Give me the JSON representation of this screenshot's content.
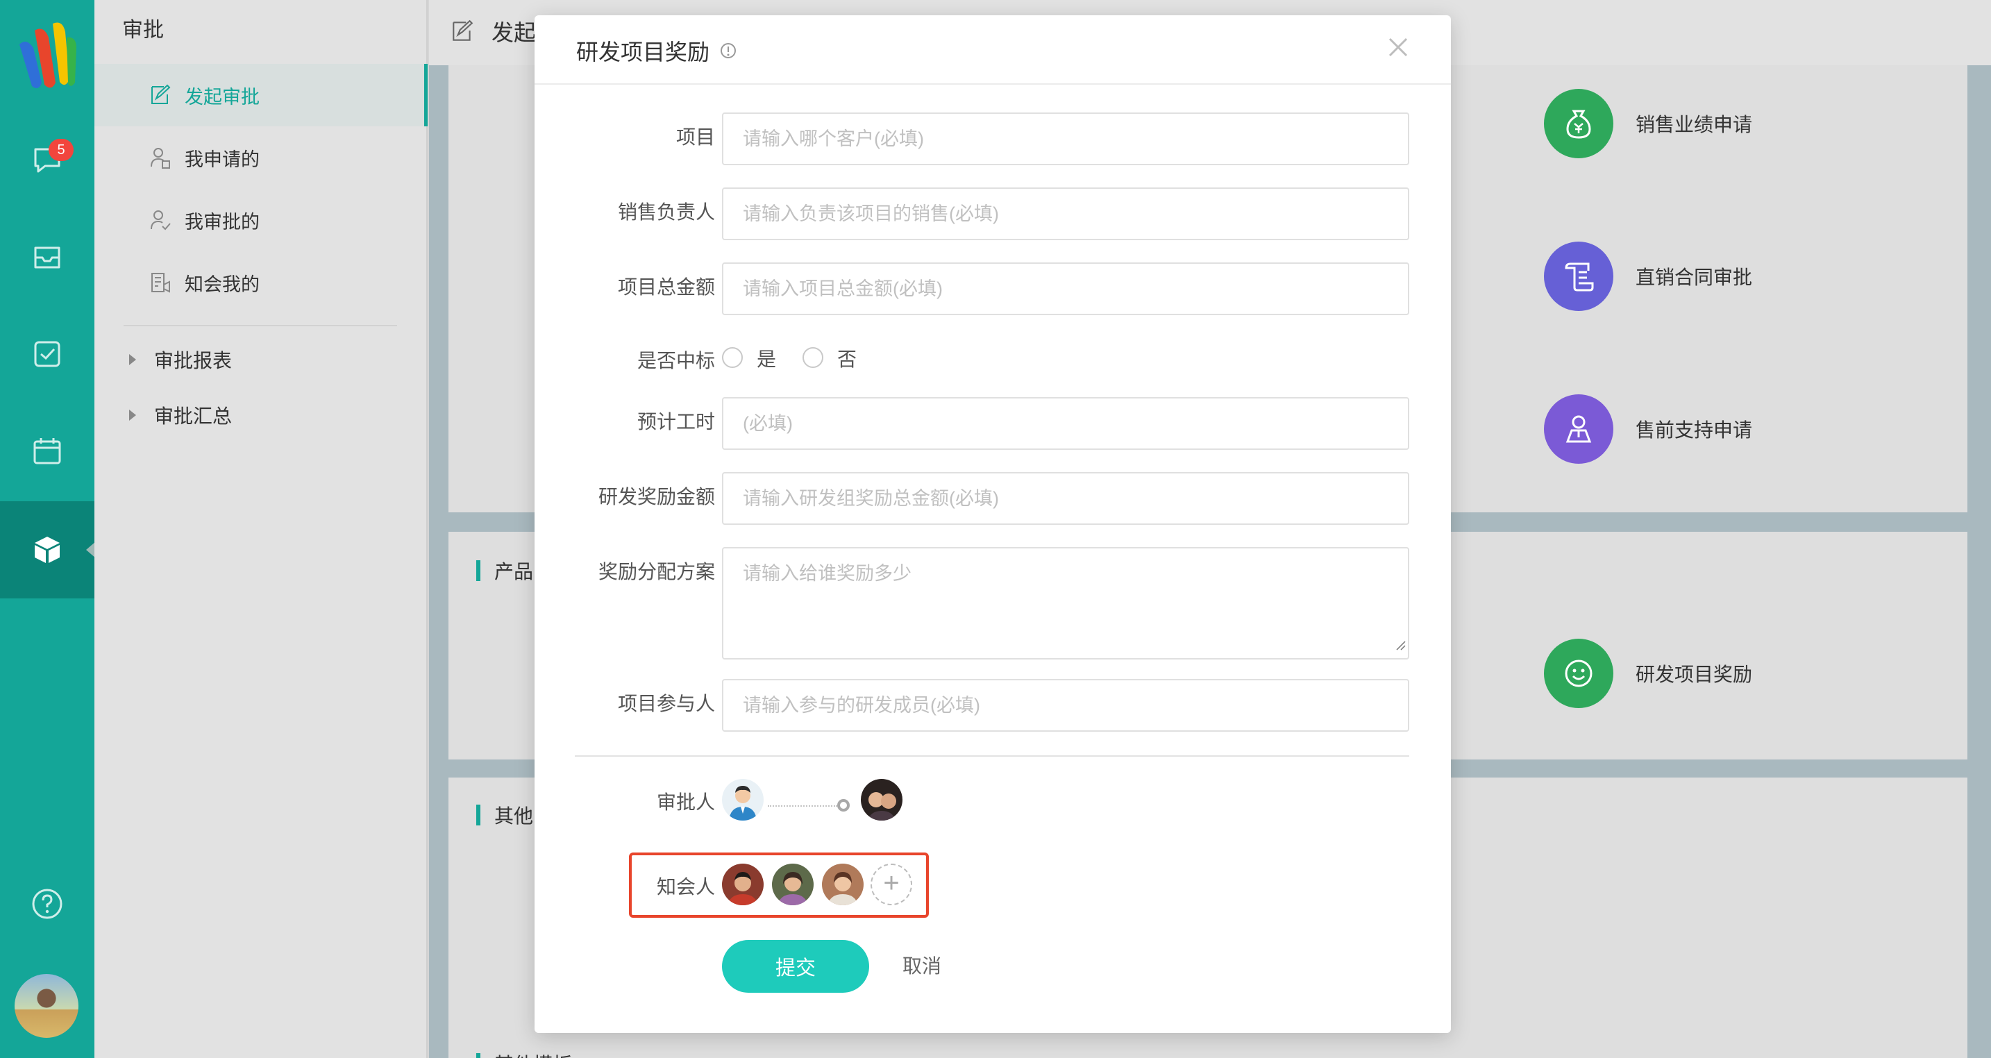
{
  "sidebar": {
    "badge_count": "5",
    "items": [
      "logo",
      "messages-icon",
      "inbox-icon",
      "task-check-icon",
      "calendar-icon",
      "apps-box-icon"
    ]
  },
  "submenu": {
    "title": "审批",
    "items": [
      {
        "label": "发起审批",
        "icon": "edit-doc-icon",
        "active": true
      },
      {
        "label": "我申请的",
        "icon": "user-doc-icon"
      },
      {
        "label": "我审批的",
        "icon": "user-check-icon"
      },
      {
        "label": "知会我的",
        "icon": "notify-doc-icon"
      }
    ],
    "groups": [
      "审批报表",
      "审批汇总"
    ]
  },
  "content": {
    "breadcrumb": "发起",
    "sections": [
      "产品",
      "其他",
      "其他模板"
    ],
    "cards": [
      {
        "label": "销售业绩申请",
        "color": "#2ea85b",
        "icon": "money-bag-icon"
      },
      {
        "label": "直销合同审批",
        "color": "#6660d6",
        "icon": "contract-icon"
      },
      {
        "label": "售前支持申请",
        "color": "#7b5ad6",
        "icon": "support-person-icon"
      },
      {
        "label": "研发项目奖励",
        "color": "#2ea85b",
        "icon": "smile-icon"
      }
    ]
  },
  "modal": {
    "title": "研发项目奖励",
    "fields": {
      "project": {
        "label": "项目",
        "placeholder": "请输入哪个客户(必填)"
      },
      "sales_owner": {
        "label": "销售负责人",
        "placeholder": "请输入负责该项目的销售(必填)"
      },
      "total_amount": {
        "label": "项目总金额",
        "placeholder": "请输入项目总金额(必填)"
      },
      "won_bid": {
        "label": "是否中标",
        "options": [
          "是",
          "否"
        ]
      },
      "est_hours": {
        "label": "预计工时",
        "placeholder": "(必填)"
      },
      "reward_amount": {
        "label": "研发奖励金额",
        "placeholder": "请输入研发组奖励总金额(必填)"
      },
      "reward_plan": {
        "label": "奖励分配方案",
        "placeholder": "请输入给谁奖励多少"
      },
      "members": {
        "label": "项目参与人",
        "placeholder": "请输入参与的研发成员(必填)"
      }
    },
    "approvers_label": "审批人",
    "cc_label": "知会人",
    "submit_label": "提交",
    "cancel_label": "取消"
  },
  "colors": {
    "accent": "#14a698",
    "submit": "#1ecbbb",
    "highlight": "#e8452c"
  }
}
